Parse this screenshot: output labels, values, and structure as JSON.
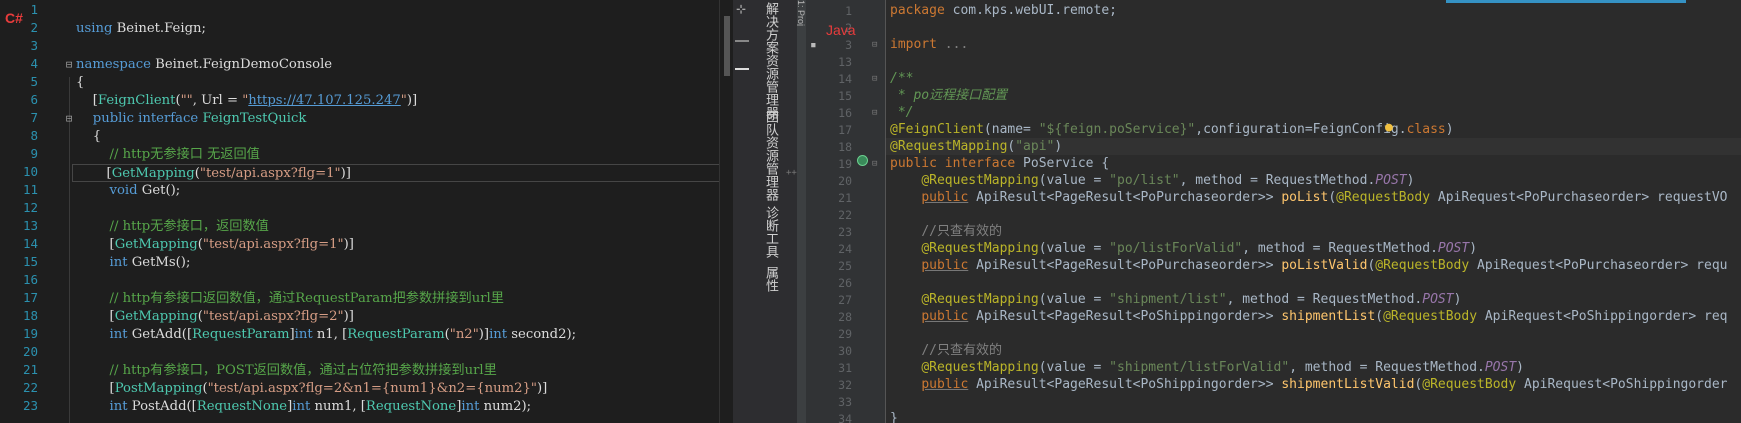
{
  "left_editor": {
    "language_badge": "C#",
    "lines": [
      {
        "n": "1",
        "html": ""
      },
      {
        "n": "2",
        "html": "<span class=\"kw\">using</span> Beinet.Feign;"
      },
      {
        "n": "3",
        "html": ""
      },
      {
        "n": "4",
        "html": "<span class=\"kw\">namespace</span> Beinet.FeignDemoConsole"
      },
      {
        "n": "5",
        "html": "{"
      },
      {
        "n": "6",
        "html": "    [<span class=\"ty\">FeignClient</span>(<span class=\"st\">\"\"</span>, Url = <span class=\"st\">\"</span><span class=\"lk\">https://47.107.125.247</span><span class=\"st\">\"</span>)]"
      },
      {
        "n": "7",
        "html": "    <span class=\"kw\">public interface</span> <span class=\"ty\">FeignTestQuick</span>"
      },
      {
        "n": "8",
        "html": "    {"
      },
      {
        "n": "9",
        "html": "        <span class=\"cm\">// http无参接口 无返回值</span>"
      },
      {
        "n": "10",
        "html": "        [<span class=\"ty\">GetMapping</span>(<span class=\"st\">\"test/api.aspx?flg=1\"</span>)]"
      },
      {
        "n": "11",
        "html": "        <span class=\"kw\">void</span> Get();"
      },
      {
        "n": "12",
        "html": ""
      },
      {
        "n": "13",
        "html": "        <span class=\"cm\">// http无参接口，返回数值</span>"
      },
      {
        "n": "14",
        "html": "        [<span class=\"ty\">GetMapping</span>(<span class=\"st\">\"test/api.aspx?flg=1\"</span>)]"
      },
      {
        "n": "15",
        "html": "        <span class=\"kw\">int</span> GetMs();"
      },
      {
        "n": "16",
        "html": ""
      },
      {
        "n": "17",
        "html": "        <span class=\"cm\">// http有参接口返回数值，通过RequestParam把参数拼接到url里</span>"
      },
      {
        "n": "18",
        "html": "        [<span class=\"ty\">GetMapping</span>(<span class=\"st\">\"test/api.aspx?flg=2\"</span>)]"
      },
      {
        "n": "19",
        "html": "        <span class=\"kw\">int</span> GetAdd([<span class=\"ty\">RequestParam</span>]<span class=\"kw\">int</span> n1, [<span class=\"ty\">RequestParam</span>(<span class=\"st\">\"n2\"</span>)]<span class=\"kw\">int</span> second2);"
      },
      {
        "n": "20",
        "html": ""
      },
      {
        "n": "21",
        "html": "        <span class=\"cm\">// http有参接口，POST返回数值，通过占位符把参数拼接到url里</span>"
      },
      {
        "n": "22",
        "html": "        [<span class=\"ty\">PostMapping</span>(<span class=\"st\">\"test/api.aspx?flg=2&amp;n1={num1}&amp;n2={num2}\"</span>)]"
      },
      {
        "n": "23",
        "html": "        <span class=\"kw\">int</span> PostAdd([<span class=\"ty\">RequestNone</span>]<span class=\"kw\">int</span> num1, [<span class=\"ty\">RequestNone</span>]<span class=\"kw\">int</span> num2);"
      }
    ]
  },
  "side_tabs": [
    "解决方案资源管理器",
    "团队资源管理器",
    "诊断工具",
    "属性"
  ],
  "right_editor": {
    "language_badge": "Java",
    "project_tab": "1: Proj",
    "lines": [
      {
        "n": "1",
        "html": "<span class=\"ik\">package</span> com.kps.webUI.remote;"
      },
      {
        "n": "2",
        "html": ""
      },
      {
        "n": "3",
        "html": "<span class=\"ik\">import</span> <span class=\"icm\">...</span>"
      },
      {
        "n": "13",
        "html": ""
      },
      {
        "n": "14",
        "html": "<span class=\"ic\">/**</span>"
      },
      {
        "n": "15",
        "html": "<span class=\"ic\"> * po远程接口配置</span>"
      },
      {
        "n": "16",
        "html": "<span class=\"ic\"> */</span>"
      },
      {
        "n": "17",
        "html": "<span class=\"ia\">@FeignClient</span>(name= <span class=\"is\">\"${feign.poService}\"</span>,configuration=FeignConfig.<span class=\"ik\">class</span>)"
      },
      {
        "n": "18",
        "html": "<span class=\"ia\">@RequestMapping</span>(<span class=\"is\">\"api\"</span>)"
      },
      {
        "n": "19",
        "html": "<span class=\"ik\">public interface</span> PoService {"
      },
      {
        "n": "20",
        "html": "    <span class=\"ia\">@RequestMapping</span>(value = <span class=\"is\">\"po/list\"</span>, method = RequestMethod.<span class=\"ip\">POST</span>)"
      },
      {
        "n": "21",
        "html": "    <span class=\"ik und\">public</span> ApiResult&lt;PageResult&lt;PoPurchaseorder&gt;&gt; <span class=\"im\">poList</span>(<span class=\"ia\">@RequestBody</span> ApiRequest&lt;PoPurchaseorder&gt; requestVO"
      },
      {
        "n": "22",
        "html": ""
      },
      {
        "n": "23",
        "html": "    <span class=\"icm\">//只查有效的</span>"
      },
      {
        "n": "24",
        "html": "    <span class=\"ia\">@RequestMapping</span>(value = <span class=\"is\">\"po/listForValid\"</span>, method = RequestMethod.<span class=\"ip\">POST</span>)"
      },
      {
        "n": "25",
        "html": "    <span class=\"ik und\">public</span> ApiResult&lt;PageResult&lt;PoPurchaseorder&gt;&gt; <span class=\"im\">poListValid</span>(<span class=\"ia\">@RequestBody</span> ApiRequest&lt;PoPurchaseorder&gt; requ"
      },
      {
        "n": "26",
        "html": ""
      },
      {
        "n": "27",
        "html": "    <span class=\"ia\">@RequestMapping</span>(value = <span class=\"is\">\"shipment/list\"</span>, method = RequestMethod.<span class=\"ip\">POST</span>)"
      },
      {
        "n": "28",
        "html": "    <span class=\"ik und\">public</span> ApiResult&lt;PageResult&lt;PoShippingorder&gt;&gt; <span class=\"im\">shipmentList</span>(<span class=\"ia\">@RequestBody</span> ApiRequest&lt;PoShippingorder&gt; req"
      },
      {
        "n": "29",
        "html": ""
      },
      {
        "n": "30",
        "html": "    <span class=\"icm\">//只查有效的</span>"
      },
      {
        "n": "31",
        "html": "    <span class=\"ia\">@RequestMapping</span>(value = <span class=\"is\">\"shipment/listForValid\"</span>, method = RequestMethod.<span class=\"ip\">POST</span>)"
      },
      {
        "n": "32",
        "html": "    <span class=\"ik und\">public</span> ApiResult&lt;PageResult&lt;PoShippingorder&gt;&gt; <span class=\"im\">shipmentListValid</span>(<span class=\"ia\">@RequestBody</span> ApiRequest&lt;PoShippingorder"
      },
      {
        "n": "33",
        "html": ""
      },
      {
        "n": "34",
        "html": "}"
      }
    ]
  }
}
